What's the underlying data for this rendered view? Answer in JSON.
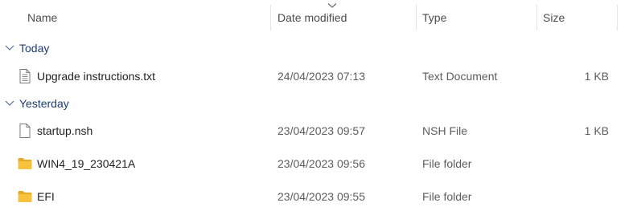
{
  "columns": {
    "name": "Name",
    "date_modified": "Date modified",
    "type": "Type",
    "size": "Size"
  },
  "sort": {
    "column": "date_modified",
    "direction": "descending",
    "icon": "chevron-down-icon"
  },
  "groups": [
    {
      "label": "Today",
      "expanded": true,
      "items": [
        {
          "name": "Upgrade instructions.txt",
          "date": "24/04/2023 07:13",
          "type": "Text Document",
          "size": "1 KB",
          "icon": "text-file-icon"
        }
      ]
    },
    {
      "label": "Yesterday",
      "expanded": true,
      "items": [
        {
          "name": "startup.nsh",
          "date": "23/04/2023 09:57",
          "type": "NSH File",
          "size": "1 KB",
          "icon": "file-icon"
        },
        {
          "name": "WIN4_19_230421A",
          "date": "23/04/2023 09:56",
          "type": "File folder",
          "size": "",
          "icon": "folder-icon"
        },
        {
          "name": "EFI",
          "date": "23/04/2023 09:55",
          "type": "File folder",
          "size": "",
          "icon": "folder-icon"
        }
      ]
    }
  ],
  "colors": {
    "folder": "#F7C23C",
    "group_label": "#1E3C6E",
    "header_text": "#4C4C4C",
    "separator": "#E5E5E5"
  }
}
